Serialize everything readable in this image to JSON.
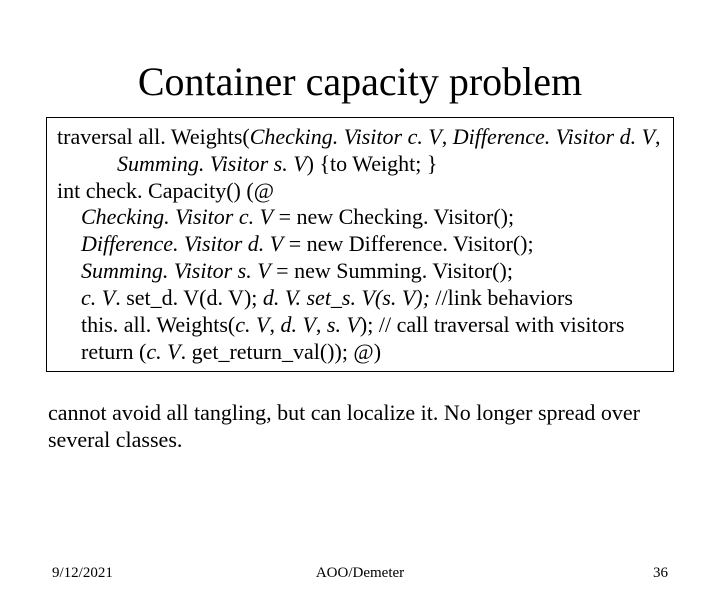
{
  "title": "Container capacity problem",
  "code": {
    "l1a": "traversal all. Weights(",
    "l1b": "Checking. Visitor c. V",
    "l1c": ", ",
    "l1d": "Difference. Visitor d. V",
    "l1e": ",",
    "l2a": "Summing. Visitor s. V",
    "l2b": ") {to Weight; }",
    "l3": "int check. Capacity() (@",
    "l4a": "Checking. Visitor c. V",
    "l4b": " = new Checking. Visitor();",
    "l5a": "Difference. Visitor d. V",
    "l5b": " = new Difference. Visitor();",
    "l6a": "Summing. Visitor s. V",
    "l6b": " = new Summing. Visitor();",
    "l7a": "c. V",
    "l7b": ". set_d. V(d. V); ",
    "l7c": "d. V. set_s. V(s. V);",
    "l7d": " //link behaviors",
    "l8a": "this. all. Weights(",
    "l8b": "c. V",
    "l8c": ", ",
    "l8d": "d. V",
    "l8e": ", ",
    "l8f": "s. V",
    "l8g": "); // call traversal with visitors",
    "l9a": "return (",
    "l9b": "c. V",
    "l9c": ". get_return_val());  @)"
  },
  "caption": "cannot avoid all tangling, but can localize it. No longer spread over several classes.",
  "footer": {
    "date": "9/12/2021",
    "mid": "AOO/Demeter",
    "page": "36"
  }
}
